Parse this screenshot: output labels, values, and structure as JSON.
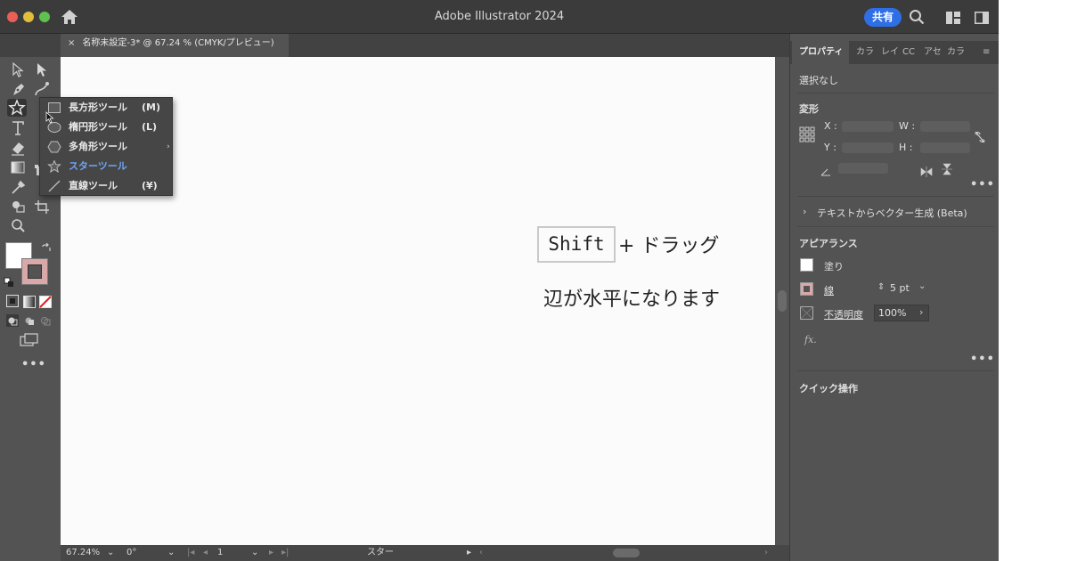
{
  "window": {
    "title": "Adobe Illustrator 2024",
    "share_label": "共有"
  },
  "document_tab": {
    "close_glyph": "×",
    "label": "名称未設定-3* @ 67.24 % (CMYK/プレビュー)"
  },
  "flyout": {
    "items": [
      {
        "label": "長方形ツール",
        "key": "(M)",
        "icon": "rectangle-icon"
      },
      {
        "label": "楕円形ツール",
        "key": "(L)",
        "icon": "ellipse-icon"
      },
      {
        "label": "多角形ツール",
        "key": "",
        "icon": "polygon-icon"
      },
      {
        "label": "スターツール",
        "key": "",
        "icon": "star-icon",
        "active": true
      },
      {
        "label": "直線ツール",
        "key": "(¥)",
        "icon": "line-icon"
      }
    ]
  },
  "canvas": {
    "key_label": "Shift",
    "plus_drag": "+ ドラッグ",
    "caption": "辺が水平になります"
  },
  "statusbar": {
    "zoom": "67.24%",
    "rotation": "0°",
    "artboard": "1",
    "tool_name": "スター"
  },
  "panel": {
    "tabs": [
      "プロパティ",
      "カラ",
      "レイ",
      "CC",
      "アセ",
      "カラ"
    ],
    "selection": "選択なし",
    "transform_title": "変形",
    "x_label": "X :",
    "y_label": "Y :",
    "w_label": "W :",
    "h_label": "H :",
    "text_to_vector": "テキストからベクター生成 (Beta)",
    "appearance_title": "アピアランス",
    "fill_label": "塗り",
    "stroke_label": "線",
    "stroke_weight": "5 pt",
    "opacity_label": "不透明度",
    "opacity_value": "100%",
    "fx_label": "fx.",
    "quick_actions": "クイック操作",
    "more_glyph": "•••"
  },
  "colors": {
    "accent": "#2f6fe6",
    "fill_swatch": "#ffffff",
    "stroke_swatch": "#d9a9a9"
  }
}
